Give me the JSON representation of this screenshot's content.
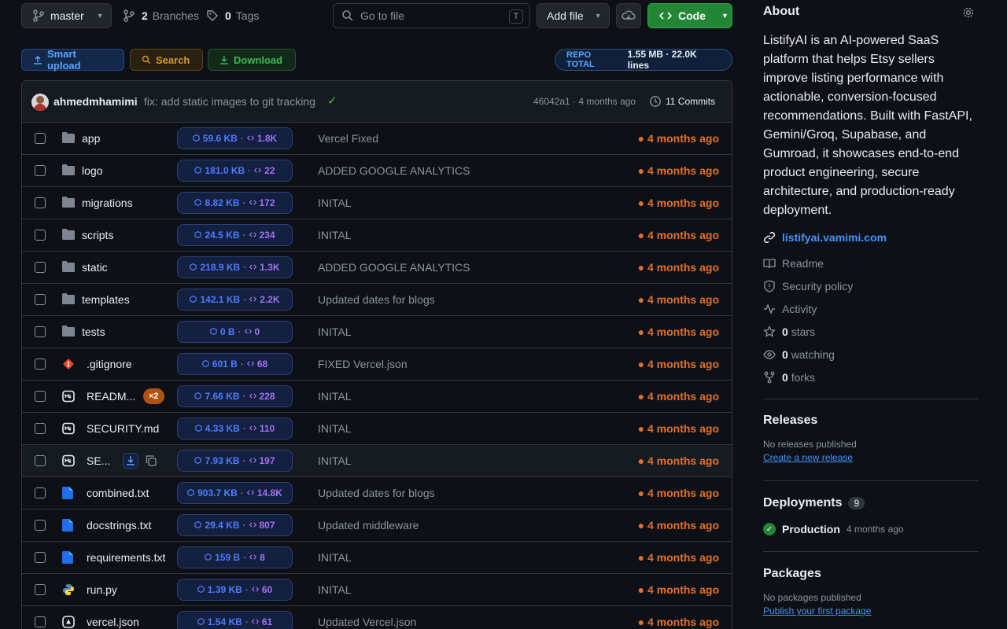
{
  "toolbar": {
    "branch": "master",
    "branches_count": "2",
    "branches_label": "Branches",
    "tags_count": "0",
    "tags_label": "Tags",
    "goto_placeholder": "Go to file",
    "goto_shortcut": "T",
    "add_file": "Add file",
    "code": "Code"
  },
  "actions": {
    "smart_upload": "Smart upload",
    "search": "Search",
    "download": "Download",
    "repo_total_label": "REPO TOTAL",
    "repo_total_value": "1.55 MB · 22.0K lines"
  },
  "commit": {
    "author": "ahmedmhamimi",
    "message": "fix: add static images to git tracking",
    "sha_age": "46042a1 · 4 months ago",
    "commits": "11 Commits"
  },
  "files": [
    {
      "name": "app",
      "icon": "folder-icon",
      "size": "59.6 KB",
      "lines": "1.8K",
      "message": "Vercel Fixed",
      "age": "● 4 months ago"
    },
    {
      "name": "logo",
      "icon": "folder-icon",
      "size": "181.0 KB",
      "lines": "22",
      "message": "ADDED GOOGLE ANALYTICS",
      "age": "● 4 months ago"
    },
    {
      "name": "migrations",
      "icon": "folder-icon",
      "size": "8.82 KB",
      "lines": "172",
      "message": "INITAL",
      "age": "● 4 months ago"
    },
    {
      "name": "scripts",
      "icon": "folder-icon",
      "size": "24.5 KB",
      "lines": "234",
      "message": "INITAL",
      "age": "● 4 months ago"
    },
    {
      "name": "static",
      "icon": "folder-icon",
      "size": "218.9 KB",
      "lines": "1.3K",
      "message": "ADDED GOOGLE ANALYTICS",
      "age": "● 4 months ago"
    },
    {
      "name": "templates",
      "icon": "folder-icon",
      "size": "142.1 KB",
      "lines": "2.2K",
      "message": "Updated dates for blogs",
      "age": "● 4 months ago"
    },
    {
      "name": "tests",
      "icon": "folder-icon",
      "size": "0 B",
      "lines": "0",
      "message": "INITAL",
      "age": "● 4 months ago"
    },
    {
      "name": ".gitignore",
      "icon": "git-icon",
      "size": "601 B",
      "lines": "68",
      "message": "FIXED Vercel.json",
      "age": "● 4 months ago"
    },
    {
      "name": "READM...",
      "icon": "markdown-icon",
      "badge": "×2",
      "size": "7.66 KB",
      "lines": "228",
      "message": "INITAL",
      "age": "● 4 months ago"
    },
    {
      "name": "SECURITY.md",
      "icon": "markdown-icon",
      "size": "4.33 KB",
      "lines": "110",
      "message": "INITAL",
      "age": "● 4 months ago"
    },
    {
      "name": "SE...",
      "icon": "markdown-icon",
      "size": "7.93 KB",
      "lines": "197",
      "message": "INITAL",
      "age": "● 4 months ago"
    },
    {
      "name": "combined.txt",
      "icon": "file-icon",
      "size": "903.7 KB",
      "lines": "14.8K",
      "message": "Updated dates for blogs",
      "age": "● 4 months ago"
    },
    {
      "name": "docstrings.txt",
      "icon": "file-icon",
      "size": "29.4 KB",
      "lines": "807",
      "message": "Updated middleware",
      "age": "● 4 months ago"
    },
    {
      "name": "requirements.txt",
      "icon": "file-icon",
      "size": "159 B",
      "lines": "8",
      "message": "INITAL",
      "age": "● 4 months ago"
    },
    {
      "name": "run.py",
      "icon": "python-icon",
      "size": "1.39 KB",
      "lines": "60",
      "message": "INITAL",
      "age": "● 4 months ago"
    },
    {
      "name": "vercel.json",
      "icon": "vercel-icon",
      "size": "1.54 KB",
      "lines": "61",
      "message": "Updated Vercel.json",
      "age": "● 4 months ago"
    }
  ],
  "about": {
    "title": "About",
    "description": "ListifyAI is an AI-powered SaaS platform that helps Etsy sellers improve listing performance with actionable, conversion-focused recommendations. Built with FastAPI, Gemini/Groq, Supabase, and Gumroad, it showcases end-to-end product engineering, secure architecture, and production-ready deployment.",
    "website": "listifyai.vamimi.com",
    "readme": "Readme",
    "security": "Security policy",
    "activity": "Activity",
    "stars_count": "0",
    "stars_label": "stars",
    "watching_count": "0",
    "watching_label": "watching",
    "forks_count": "0",
    "forks_label": "forks"
  },
  "releases": {
    "title": "Releases",
    "empty": "No releases published",
    "create_link": "Create a new release"
  },
  "deployments": {
    "title": "Deployments",
    "count": "9",
    "env": "Production",
    "age": "4 months ago"
  },
  "packages": {
    "title": "Packages",
    "empty": "No packages published",
    "publish_link": "Publish your first package"
  },
  "colors": {
    "background": "#0d1117",
    "accent_green": "#238636",
    "link_blue": "#4493f8",
    "age_orange": "#e0702c"
  }
}
